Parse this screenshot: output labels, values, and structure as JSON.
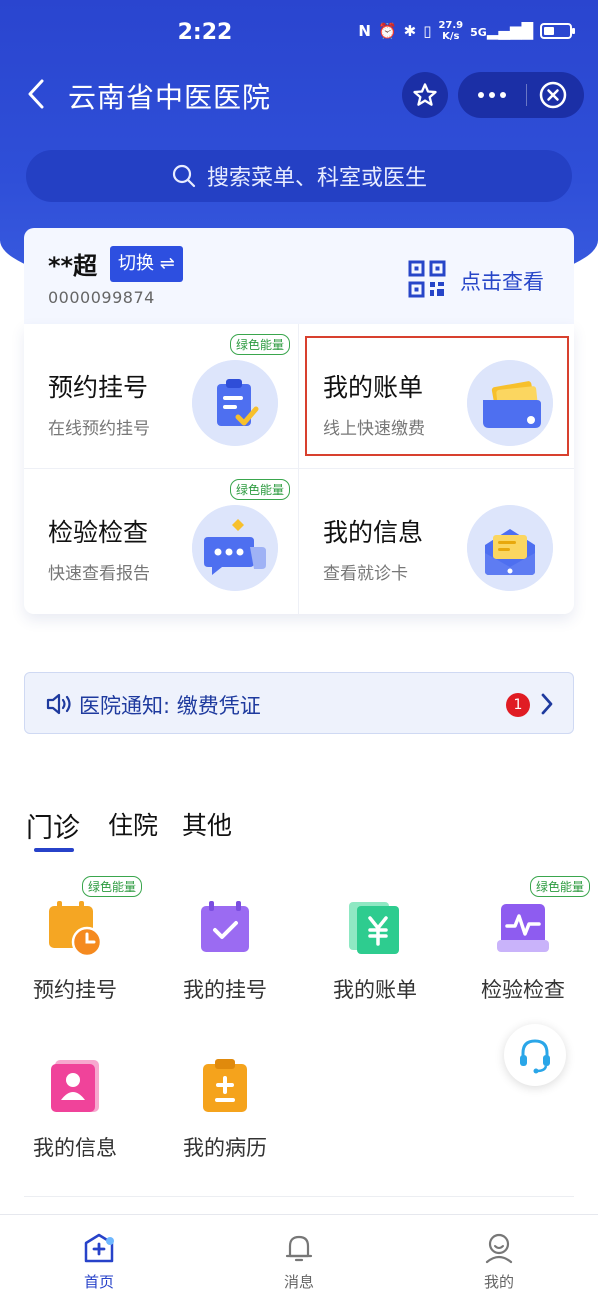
{
  "status_bar": {
    "time": "2:22",
    "net_speed_value": "27.9",
    "net_speed_unit": "K/s",
    "signal_label": "5G"
  },
  "nav": {
    "title": "云南省中医医院"
  },
  "search": {
    "placeholder": "搜索菜单、科室或医生"
  },
  "user_card": {
    "name": "**超",
    "switch_label": "切换 ⇌",
    "card_number": "0000099874",
    "qr_label": "点击查看"
  },
  "functions": [
    {
      "title": "预约挂号",
      "subtitle": "在线预约挂号",
      "badge": "绿色能量"
    },
    {
      "title": "我的账单",
      "subtitle": "线上快速缴费"
    },
    {
      "title": "检验检查",
      "subtitle": "快速查看报告",
      "badge": "绿色能量"
    },
    {
      "title": "我的信息",
      "subtitle": "查看就诊卡"
    }
  ],
  "notice": {
    "label": "医院通知:  缴费凭证",
    "count": "1"
  },
  "tabs": [
    "门诊",
    "住院",
    "其他"
  ],
  "services": [
    {
      "label": "预约挂号",
      "badge": "绿色能量",
      "icon": "calendar-clock-icon",
      "color": "#f5a623"
    },
    {
      "label": "我的挂号",
      "icon": "calendar-check-icon",
      "color": "#9b6bf2"
    },
    {
      "label": "我的账单",
      "icon": "yuan-bill-icon",
      "color": "#2ecc8f"
    },
    {
      "label": "检验检查",
      "badge": "绿色能量",
      "icon": "heartbeat-report-icon",
      "color": "#8e5cf0"
    },
    {
      "label": "我的信息",
      "icon": "person-card-icon",
      "color": "#f0439a"
    },
    {
      "label": "我的病历",
      "icon": "medical-record-icon",
      "color": "#f5a31c"
    }
  ],
  "bottom_tabs": [
    {
      "label": "首页",
      "active": true
    },
    {
      "label": "消息"
    },
    {
      "label": "我的"
    }
  ],
  "colors": {
    "brand_blue": "#2d4fe0",
    "highlight_red": "#d8402e",
    "badge_green": "#2b9a3e"
  }
}
